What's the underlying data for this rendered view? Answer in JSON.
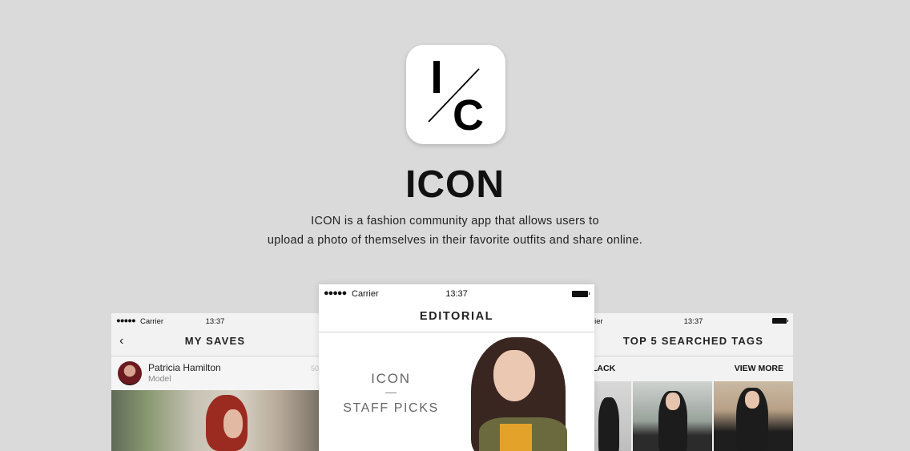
{
  "app": {
    "title": "ICON",
    "logo_text": "I/C",
    "description_line1": "ICON is a fashion community app that allows users to",
    "description_line2": "upload a photo of themselves in their favorite outfits and share online."
  },
  "colors": {
    "background": "#dadada",
    "text": "#111111",
    "accent_jacket": "#6b6a3e",
    "accent_shirt": "#e3a22a"
  },
  "phones": {
    "left": {
      "status": {
        "dots": "●●●●●",
        "carrier": "Carrier",
        "time": "13:37"
      },
      "nav_title": "MY SAVES",
      "back_icon": "‹",
      "profile": {
        "name": "Patricia Hamilton",
        "role": "Model",
        "count": "50"
      }
    },
    "center": {
      "status": {
        "dots": "●●●●●",
        "carrier": "Carrier",
        "time": "13:37"
      },
      "nav_title": "EDITORIAL",
      "label_line1": "ICON",
      "label_line2": "STAFF PICKS"
    },
    "right": {
      "status": {
        "carrier": "rier",
        "time": "13:37"
      },
      "nav_title": "TOP 5 SEARCHED TAGS",
      "tag_label": "LACK",
      "view_more": "VIEW MORE"
    }
  }
}
